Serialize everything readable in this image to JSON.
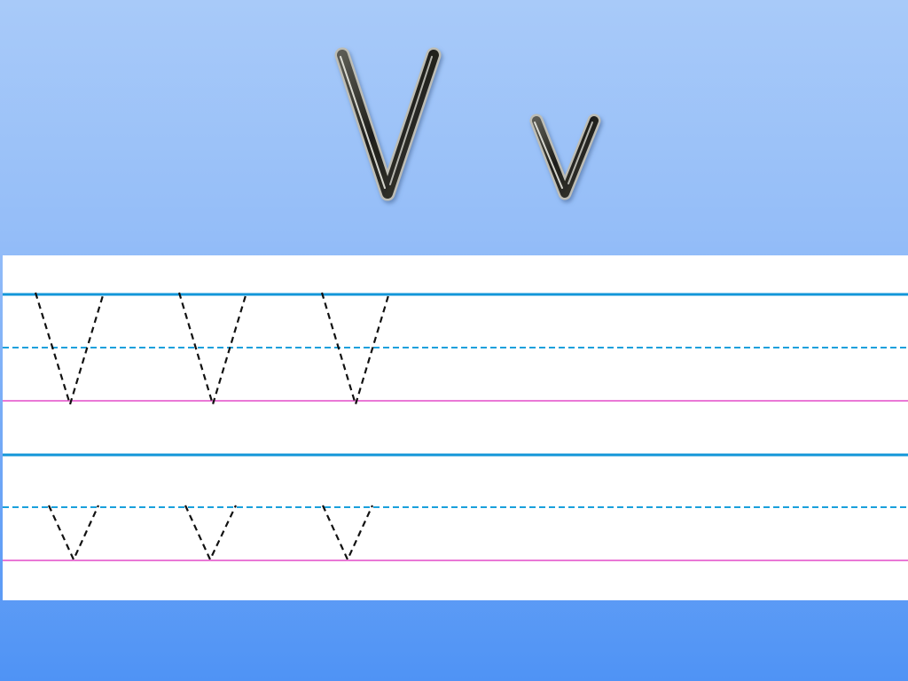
{
  "title": {
    "uppercase": "V",
    "lowercase": "v"
  },
  "practice": {
    "uppercase_row": {
      "tracing_letter": "V",
      "count": 3
    },
    "lowercase_row": {
      "tracing_letter": "v",
      "count": 3
    }
  },
  "colors": {
    "background_top": "#a8caf9",
    "background_bottom": "#4f93f5",
    "headline_blue": "#1296d8",
    "midline_blue": "#1aa0dc",
    "baseline_pink": "#ea78d6",
    "tracing_black": "#111111",
    "letter_fill": "#2a2a28"
  }
}
